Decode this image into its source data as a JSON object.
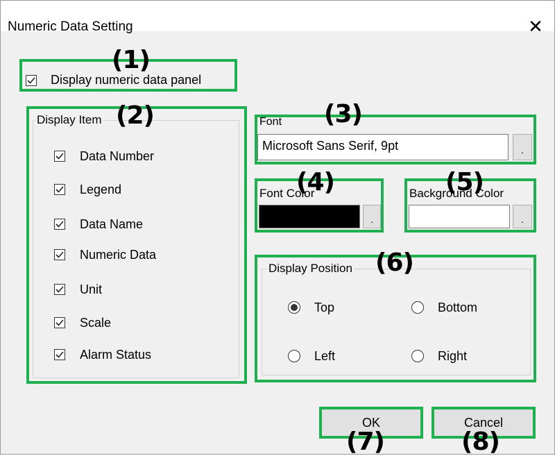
{
  "dialog": {
    "title": "Numeric Data Setting",
    "close_symbol": "✕"
  },
  "display_panel": {
    "label": "Display numeric data panel",
    "checked": true
  },
  "display_item": {
    "legend": "Display Item",
    "items": [
      {
        "label": "Data Number",
        "checked": true
      },
      {
        "label": "Legend",
        "checked": true
      },
      {
        "label": "Data Name",
        "checked": true
      },
      {
        "label": "Numeric Data",
        "checked": true
      },
      {
        "label": "Unit",
        "checked": true
      },
      {
        "label": "Scale",
        "checked": true
      },
      {
        "label": "Alarm Status",
        "checked": true
      }
    ]
  },
  "font": {
    "legend": "Font",
    "value": "Microsoft Sans Serif, 9pt",
    "browse_label": "."
  },
  "font_color": {
    "legend": "Font Color",
    "color": "#000000",
    "browse_label": "."
  },
  "background_color": {
    "legend": "Background Color",
    "color": "#ffffff",
    "browse_label": "."
  },
  "display_position": {
    "legend": "Display Position",
    "options": [
      {
        "label": "Top",
        "selected": true
      },
      {
        "label": "Bottom",
        "selected": false
      },
      {
        "label": "Left",
        "selected": false
      },
      {
        "label": "Right",
        "selected": false
      }
    ]
  },
  "buttons": {
    "ok": "OK",
    "cancel": "Cancel"
  },
  "callouts": [
    "(1)",
    "(2)",
    "(3)",
    "(4)",
    "(5)",
    "(6)",
    "(7)",
    "(8)"
  ],
  "colors": {
    "highlight": "#1fb150",
    "dialog_bg": "#f0f0f0"
  }
}
